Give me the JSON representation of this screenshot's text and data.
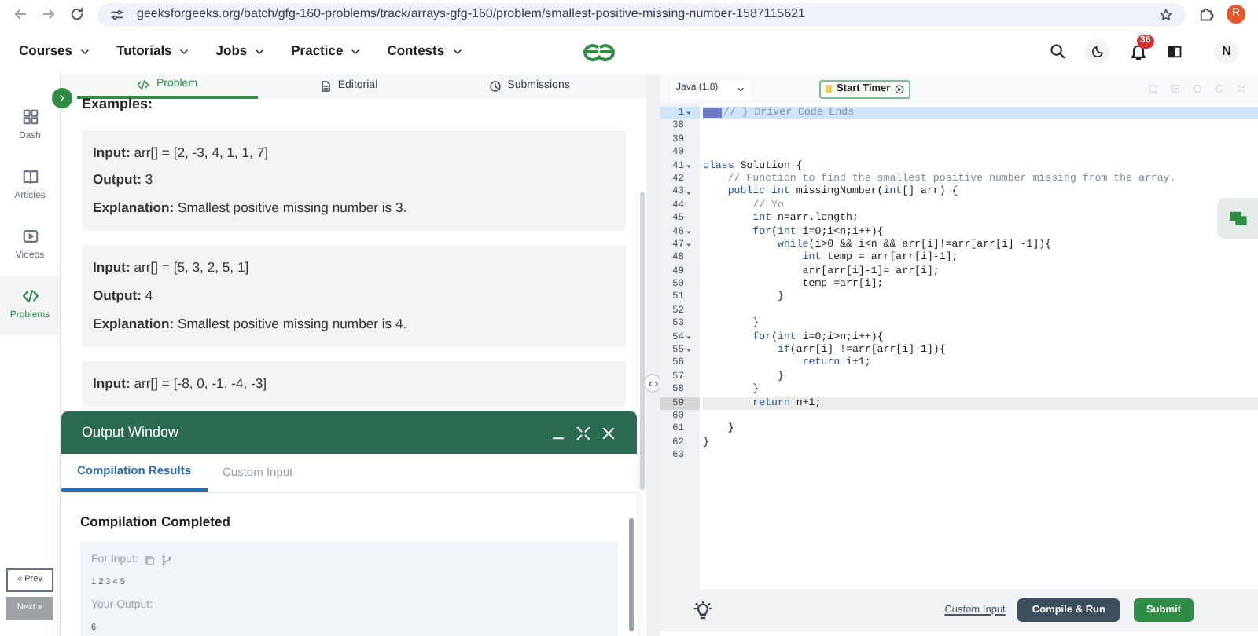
{
  "browser": {
    "url": "geeksforgeeks.org/batch/gfg-160-problems/track/arrays-gfg-160/problem/smallest-positive-missing-number-1587115621",
    "profile": "R"
  },
  "nav": {
    "menus": [
      "Courses",
      "Tutorials",
      "Jobs",
      "Practice",
      "Contests"
    ],
    "notifications": "36",
    "avatar": "N"
  },
  "sidebar": {
    "items": [
      {
        "label": "Dash",
        "selected": false
      },
      {
        "label": "Articles",
        "selected": false
      },
      {
        "label": "Videos",
        "selected": false
      },
      {
        "label": "Problems",
        "selected": true
      }
    ],
    "prev": "« Prev",
    "next": "Next »"
  },
  "problem_tabs": [
    {
      "label": "Problem",
      "selected": true
    },
    {
      "label": "Editorial",
      "selected": false
    },
    {
      "label": "Submissions",
      "selected": false
    }
  ],
  "examples_heading": "Examples:",
  "examples": [
    {
      "input": "**Input:** arr[] = [2, -3, 4, 1, 1, 7]",
      "output": "**Output:** 3",
      "explanation": "**Explanation:** Smallest positive missing number is 3."
    },
    {
      "input": "**Input:** arr[] = [5, 3, 2, 5, 1]",
      "output": "**Output:** 4",
      "explanation": "**Explanation:** Smallest positive missing number is 4."
    },
    {
      "input": "**Input:** arr[] = [-8, 0, -1, -4, -3]"
    }
  ],
  "output_window": {
    "title": "Output Window",
    "tabs": [
      {
        "label": "Compilation Results",
        "selected": true
      },
      {
        "label": "Custom Input",
        "selected": false
      }
    ],
    "status": "Compilation Completed",
    "input_label": "For Input:",
    "input": "1 2 3 4 5",
    "output_label": "Your Output:",
    "output": "6"
  },
  "editor": {
    "language": "Java (1.8)",
    "timer": "Start Timer",
    "lines": [
      {
        "num": "1",
        "fold": true,
        "selected": true,
        "active": false,
        "code": [
          {
            "kind": "comment",
            "text": "// } Driver Code Ends"
          }
        ]
      },
      {
        "num": "38",
        "fold": false,
        "selected": false,
        "active": false
      },
      {
        "num": "39",
        "fold": false,
        "selected": false,
        "active": false
      },
      {
        "num": "40",
        "fold": false,
        "selected": false,
        "active": false
      },
      {
        "num": "41",
        "fold": true,
        "selected": false,
        "active": false,
        "code": [
          {
            "kind": "keyword",
            "text": "class"
          },
          {
            "kind": "plain",
            "text": " Solution {"
          }
        ]
      },
      {
        "num": "42",
        "fold": false,
        "selected": false,
        "active": false,
        "code": [
          {
            "kind": "comment",
            "text": "    // Function to find the smallest positive number missing from the array."
          }
        ]
      },
      {
        "num": "43",
        "fold": true,
        "selected": false,
        "active": false,
        "code": [
          {
            "kind": "keyword",
            "text": "    public int"
          },
          {
            "kind": "plain",
            "text": " missingNumber("
          },
          {
            "kind": "keyword",
            "text": "int"
          },
          {
            "kind": "plain",
            "text": "[] arr) {"
          }
        ]
      },
      {
        "num": "44",
        "fold": false,
        "selected": false,
        "active": false,
        "code": [
          {
            "kind": "comment",
            "text": "        // Yo"
          }
        ]
      },
      {
        "num": "45",
        "fold": false,
        "selected": false,
        "active": false,
        "code": [
          {
            "kind": "keyword",
            "text": "        int"
          },
          {
            "kind": "plain",
            "text": " n=arr.length;"
          }
        ]
      },
      {
        "num": "46",
        "fold": true,
        "selected": false,
        "active": false,
        "code": [
          {
            "kind": "keyword",
            "text": "        for"
          },
          {
            "kind": "plain",
            "text": "("
          },
          {
            "kind": "keyword",
            "text": "int"
          },
          {
            "kind": "plain",
            "text": " i=0;i<n;i++){"
          }
        ]
      },
      {
        "num": "47",
        "fold": true,
        "selected": false,
        "active": false,
        "code": [
          {
            "kind": "keyword",
            "text": "            while"
          },
          {
            "kind": "plain",
            "text": "(i>0 && i<n && arr[i]!=arr[arr[i] -1]){"
          }
        ]
      },
      {
        "num": "48",
        "fold": false,
        "selected": false,
        "active": false,
        "code": [
          {
            "kind": "keyword",
            "text": "                int"
          },
          {
            "kind": "plain",
            "text": " temp = arr[arr[i]-1];"
          }
        ]
      },
      {
        "num": "49",
        "fold": false,
        "selected": false,
        "active": false,
        "code": [
          {
            "kind": "plain",
            "text": "                arr[arr[i]-1]= arr[i];"
          }
        ]
      },
      {
        "num": "50",
        "fold": false,
        "selected": false,
        "active": false,
        "code": [
          {
            "kind": "plain",
            "text": "                temp =arr[i];"
          }
        ]
      },
      {
        "num": "51",
        "fold": false,
        "selected": false,
        "active": false,
        "code": [
          {
            "kind": "plain",
            "text": "            }"
          }
        ]
      },
      {
        "num": "52",
        "fold": false,
        "selected": false,
        "active": false
      },
      {
        "num": "53",
        "fold": false,
        "selected": false,
        "active": false,
        "code": [
          {
            "kind": "plain",
            "text": "        }"
          }
        ]
      },
      {
        "num": "54",
        "fold": true,
        "selected": false,
        "active": false,
        "code": [
          {
            "kind": "keyword",
            "text": "        for"
          },
          {
            "kind": "plain",
            "text": "("
          },
          {
            "kind": "keyword",
            "text": "int"
          },
          {
            "kind": "plain",
            "text": " i=0;i>n;i++){"
          }
        ]
      },
      {
        "num": "55",
        "fold": true,
        "selected": false,
        "active": false,
        "code": [
          {
            "kind": "keyword",
            "text": "            if"
          },
          {
            "kind": "plain",
            "text": "(arr[i] !=arr[arr[i]-1]){"
          }
        ]
      },
      {
        "num": "56",
        "fold": false,
        "selected": false,
        "active": false,
        "code": [
          {
            "kind": "keyword",
            "text": "                return"
          },
          {
            "kind": "plain",
            "text": " i+1;"
          }
        ]
      },
      {
        "num": "57",
        "fold": false,
        "selected": false,
        "active": false,
        "code": [
          {
            "kind": "plain",
            "text": "            }"
          }
        ]
      },
      {
        "num": "58",
        "fold": false,
        "selected": false,
        "active": false,
        "code": [
          {
            "kind": "plain",
            "text": "        }"
          }
        ]
      },
      {
        "num": "59",
        "fold": false,
        "selected": false,
        "active": true,
        "code": [
          {
            "kind": "keyword",
            "text": "        return"
          },
          {
            "kind": "plain",
            "text": " n+1;"
          }
        ]
      },
      {
        "num": "60",
        "fold": false,
        "selected": false,
        "active": false
      },
      {
        "num": "61",
        "fold": false,
        "selected": false,
        "active": false,
        "code": [
          {
            "kind": "plain",
            "text": "    }"
          }
        ]
      },
      {
        "num": "62",
        "fold": false,
        "selected": false,
        "active": false,
        "code": [
          {
            "kind": "plain",
            "text": "}"
          }
        ]
      },
      {
        "num": "63",
        "fold": false,
        "selected": false,
        "active": false
      }
    ],
    "custom_input": "Custom Input",
    "compile": "Compile & Run",
    "submit": "Submit"
  }
}
